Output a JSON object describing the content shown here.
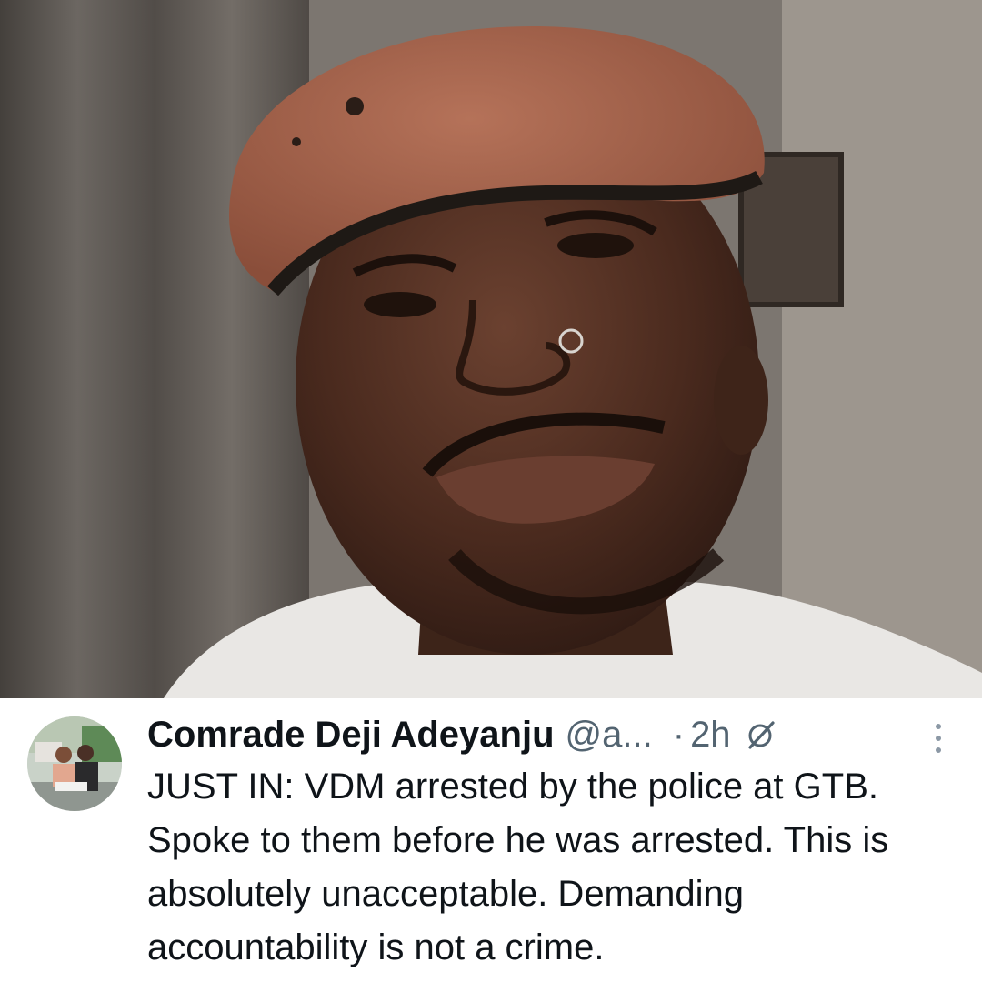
{
  "tweet": {
    "author": {
      "display_name": "Comrade Deji Adeyanju",
      "handle": "@a...",
      "avatar_icon": "user-avatar-photo"
    },
    "separator": "·",
    "timestamp": "2h",
    "grok_icon": "grok-icon",
    "more_icon": "more-options-icon",
    "text": "JUST IN: VDM arrested by the police at GTB. Spoke to them before he was arrested. This is absolutely unacceptable. Demanding accountability is not a crime."
  },
  "colors": {
    "primary_text": "#0f1419",
    "secondary_text": "#536471",
    "beret": "#a0624a",
    "background": "#ffffff"
  }
}
